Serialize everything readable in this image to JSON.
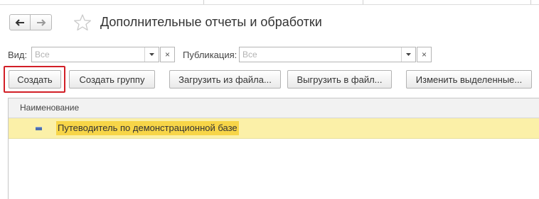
{
  "header": {
    "title": "Дополнительные отчеты и обработки",
    "back_icon": "arrow-left-icon",
    "forward_icon": "arrow-right-icon",
    "favorite_icon": "star-icon"
  },
  "filters": {
    "kind_label": "Вид:",
    "kind_placeholder": "Все",
    "publication_label": "Публикация:",
    "publication_placeholder": "Все",
    "clear_glyph": "×"
  },
  "toolbar": {
    "create_label": "Создать",
    "create_group_label": "Создать группу",
    "load_label": "Загрузить из файла...",
    "unload_label": "Выгрузить в файл...",
    "change_selected_label": "Изменить выделенные..."
  },
  "table": {
    "columns": [
      "Наименование"
    ],
    "rows": [
      {
        "name": "Путеводитель по демонстрационной базе"
      }
    ]
  },
  "colors": {
    "highlight_border": "#d21f27",
    "selected_row": "#fbf0a8",
    "selected_cell": "#f7d548"
  }
}
